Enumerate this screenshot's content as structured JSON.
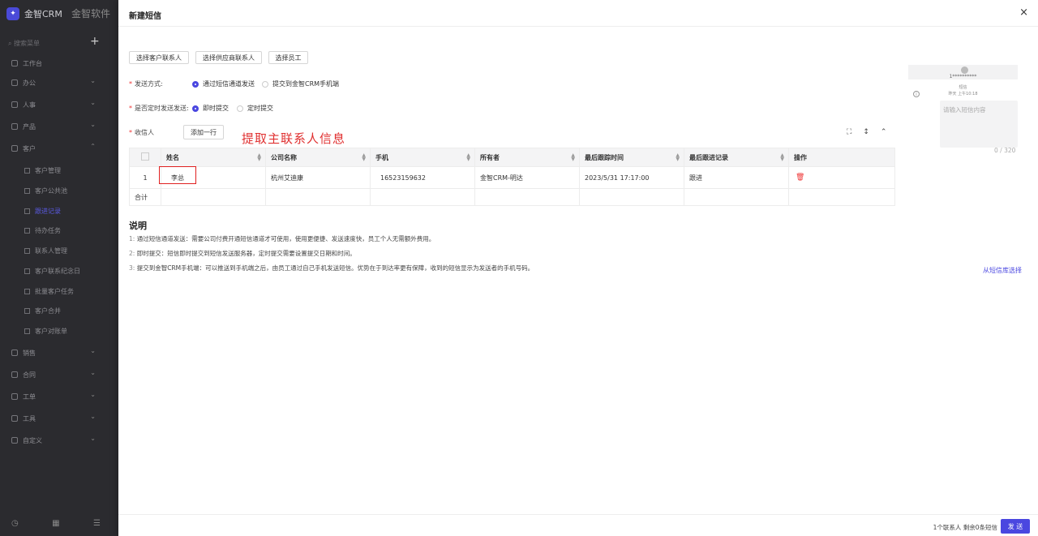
{
  "app": {
    "brand": "金智CRM",
    "bg_title": "金智软件",
    "search_placeholder": "搜索菜单",
    "plus": "+"
  },
  "sidebar": {
    "menu": [
      {
        "label": "工作台",
        "chevron": ""
      },
      {
        "label": "办公",
        "chevron": "⌄"
      },
      {
        "label": "人事",
        "chevron": "⌄"
      },
      {
        "label": "产品",
        "chevron": "⌄"
      },
      {
        "label": "客户",
        "chevron": "⌃"
      }
    ],
    "sub": [
      {
        "label": "客户管理"
      },
      {
        "label": "客户公共池"
      },
      {
        "label": "跟进记录"
      },
      {
        "label": "待办任务"
      },
      {
        "label": "联系人管理"
      },
      {
        "label": "客户联系纪念日"
      },
      {
        "label": "批量客户任务"
      },
      {
        "label": "客户合并"
      },
      {
        "label": "客户对账单"
      }
    ],
    "menu2": [
      {
        "label": "销售",
        "chevron": "⌄"
      },
      {
        "label": "合同",
        "chevron": "⌄"
      },
      {
        "label": "工单",
        "chevron": "⌄"
      },
      {
        "label": "工具",
        "chevron": "⌄"
      },
      {
        "label": "自定义",
        "chevron": "⌄"
      }
    ]
  },
  "drawer": {
    "title": "新建短信",
    "close": "×",
    "buttons": {
      "select_customer": "选择客户联系人",
      "select_supplier": "选择供应商联系人",
      "select_staff": "选择员工"
    },
    "send_method": {
      "label": "发送方式:",
      "opt1": "通过短信通道发送",
      "opt2": "提交到金智CRM手机端"
    },
    "timed": {
      "label": "是否定时发送发送:",
      "opt1": "即时提交",
      "opt2": "定时提交"
    },
    "recipient": {
      "label": "收信人",
      "add_row": "添加一行"
    },
    "annotation": "提取主联系人信息",
    "table": {
      "headers": [
        "",
        "姓名",
        "公司名称",
        "手机",
        "所有者",
        "最后跟踪时间",
        "最后跟进记录",
        "操作"
      ],
      "row": {
        "index": "1",
        "name": "李总",
        "company": "杭州艾迪康",
        "phone": "16523159632",
        "owner": "金智CRM-明达",
        "last_time": "2023/5/31 17:17:00",
        "last_record": "跟进",
        "action": "🗑"
      },
      "sum_label": "合计"
    },
    "notes": {
      "title": "说明",
      "items": [
        {
          "num": "1:",
          "text": "通过短信通道发送：需要公司付费开通短信通道才可使用，使用更便捷、发送速度快，员工个人无需额外费用。"
        },
        {
          "num": "2:",
          "text": "即时提交：短信即时提交到短信发送服务器，定时提交需要设置提交日期和时间。"
        },
        {
          "num": "3:",
          "text": "提交到金智CRM手机端：可以推送到手机端之后，由员工通过自己手机发送短信。优势在于到达率更有保障，收到的短信显示为发送者的手机号码。"
        }
      ]
    },
    "from_library": "从短信库选择",
    "preview": {
      "number": "1**********",
      "label": "短信",
      "time": "昨天 上午10:18",
      "placeholder": "请输入短信内容",
      "counter": "0 / 320"
    },
    "footer": {
      "info": "1个联系人  剩余0条短信",
      "send": "发 送"
    }
  },
  "colors": {
    "accent": "#4a47e0",
    "danger": "#e02020",
    "sidebar_bg": "#2b2b2f"
  }
}
